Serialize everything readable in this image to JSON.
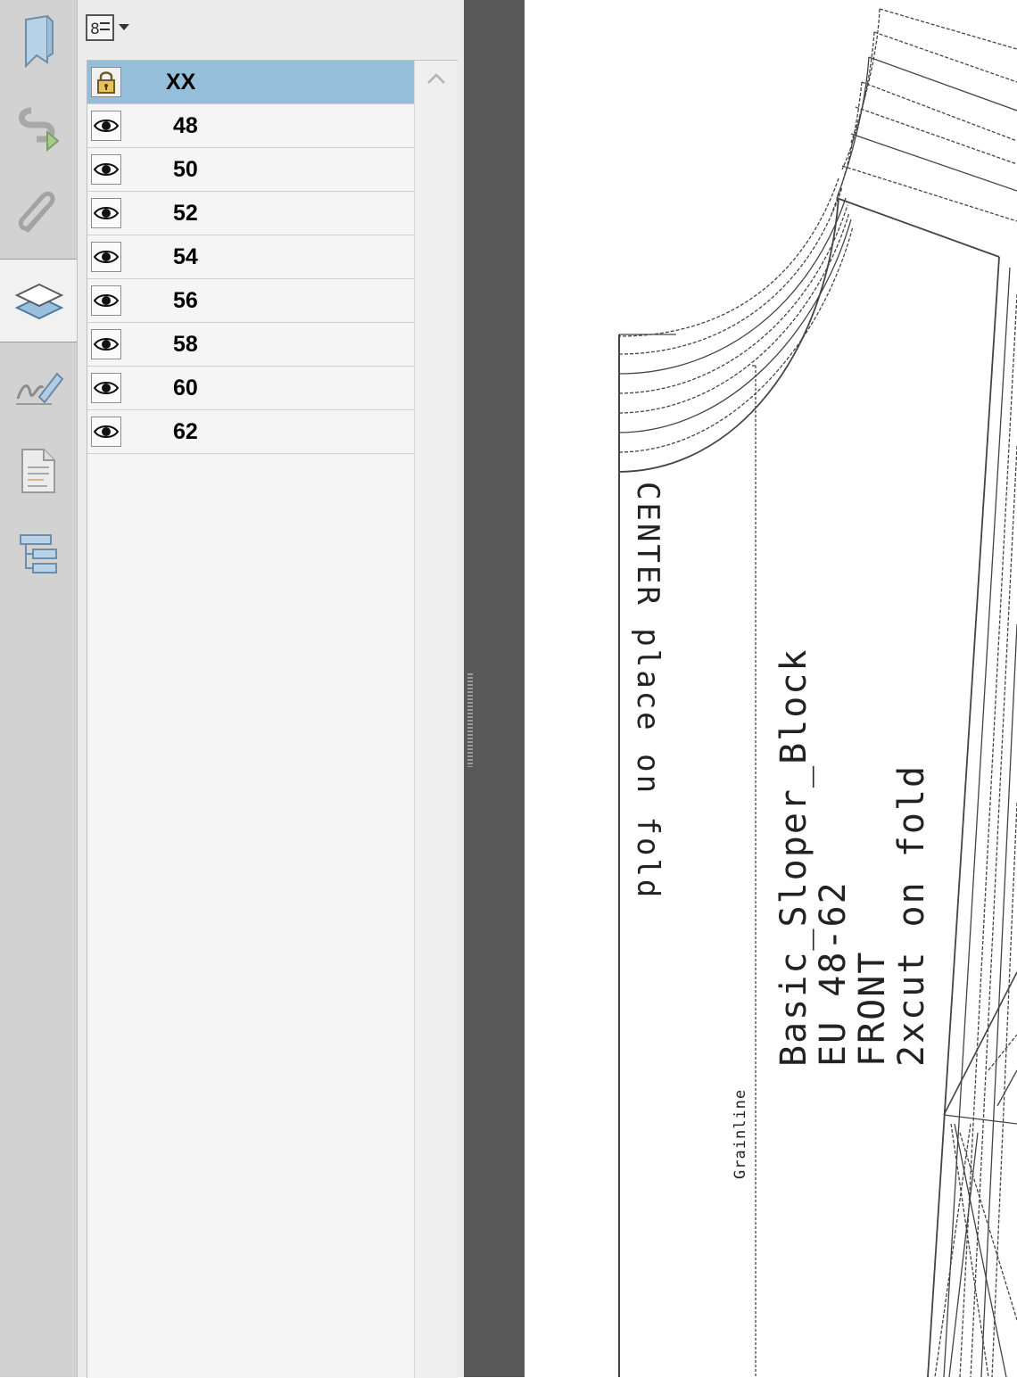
{
  "rail": {
    "items": [
      {
        "icon": "bookmark-icon"
      },
      {
        "icon": "destinations-icon"
      },
      {
        "icon": "attachment-icon"
      },
      {
        "icon": "layers-icon",
        "active": true
      },
      {
        "icon": "signature-icon"
      },
      {
        "icon": "page-thumbnails-icon"
      },
      {
        "icon": "model-tree-icon"
      }
    ]
  },
  "layers_panel": {
    "options_icon": "layer-options-icon",
    "layers": [
      {
        "name": "XX",
        "icon": "lock-icon",
        "selected": true
      },
      {
        "name": "48",
        "icon": "eye-icon"
      },
      {
        "name": "50",
        "icon": "eye-icon"
      },
      {
        "name": "52",
        "icon": "eye-icon"
      },
      {
        "name": "54",
        "icon": "eye-icon"
      },
      {
        "name": "56",
        "icon": "eye-icon"
      },
      {
        "name": "58",
        "icon": "eye-icon"
      },
      {
        "name": "60",
        "icon": "eye-icon"
      },
      {
        "name": "62",
        "icon": "eye-icon"
      }
    ]
  },
  "document": {
    "center_label": "CENTER place on fold",
    "grainline_label": "Grainline",
    "pattern_title": "Basic_Sloper_Block",
    "size_range": "EU 48-62",
    "piece": "FRONT",
    "cut_instruction": "2xcut on fold"
  }
}
